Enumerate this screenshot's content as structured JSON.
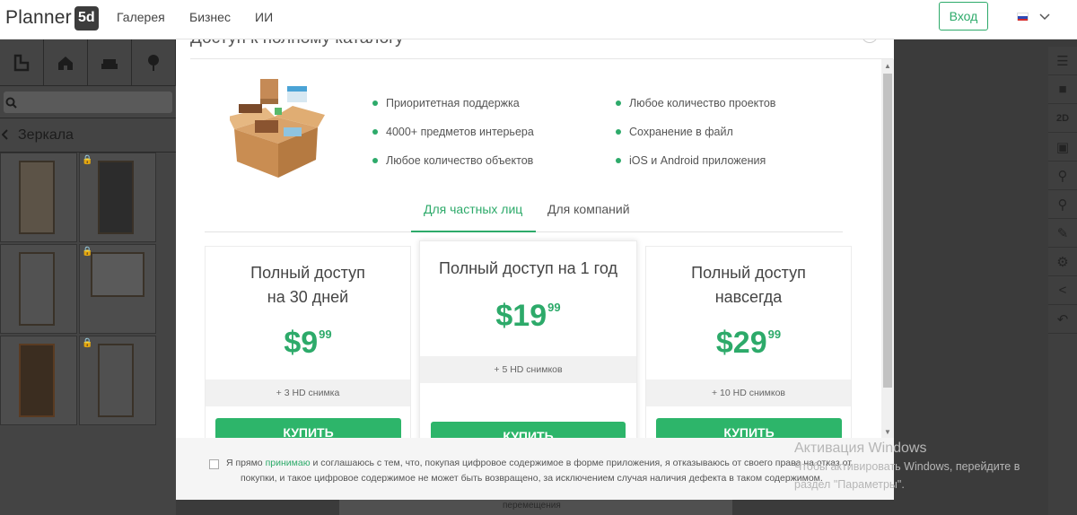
{
  "header": {
    "logo_text": "Planner",
    "logo_badge": "5d",
    "nav": [
      "Галерея",
      "Бизнес",
      "ИИ"
    ],
    "login_label": "Вход",
    "language_icon": "flag-ru-icon",
    "language_chevron_icon": "chevron-down-icon"
  },
  "background": {
    "category_label": "Зеркала",
    "bottom_label": "перемещения"
  },
  "modal": {
    "title": "Доступ к полному каталогу",
    "features_left": [
      "Приоритетная поддержка",
      "4000+ предметов интерьера",
      "Любое количество объектов"
    ],
    "features_right": [
      "Любое количество проектов",
      "Сохранение в файл",
      "iOS и Android приложения"
    ],
    "tabs": [
      "Для частных лиц",
      "Для компаний"
    ],
    "active_tab": 0,
    "plans": [
      {
        "title_line1": "Полный доступ",
        "title_line2": "на 30 дней",
        "price": "$9",
        "cents": "99",
        "extra": "+ 3 HD снимка",
        "button": "КУПИТЬ"
      },
      {
        "title_line1": "Полный доступ на 1 год",
        "title_line2": "",
        "price": "$19",
        "cents": "99",
        "extra": "+ 5 HD снимков",
        "button": "КУПИТЬ"
      },
      {
        "title_line1": "Полный доступ",
        "title_line2": "навсегда",
        "price": "$29",
        "cents": "99",
        "extra": "+ 10 HD снимков",
        "button": "КУПИТЬ"
      }
    ],
    "consent": {
      "part1": "Я прямо ",
      "link": "принимаю",
      "part2": " и соглашаюсь с тем, что, покупая цифровое содержимое в форме приложения, я отказываюсь от своего права на отказ от",
      "line2": "покупки, и такое цифровое содержимое не может быть возвращено, за исключением случая наличия дефекта в таком содержимом."
    }
  },
  "windows_watermark": {
    "title": "Активация Windows",
    "line1": "Чтобы активировать Windows, перейдите в",
    "line2": "раздел \"Параметры\"."
  },
  "colors": {
    "accent": "#2daa6a",
    "button": "#2db56a",
    "overlay": "#3b3b3b"
  }
}
